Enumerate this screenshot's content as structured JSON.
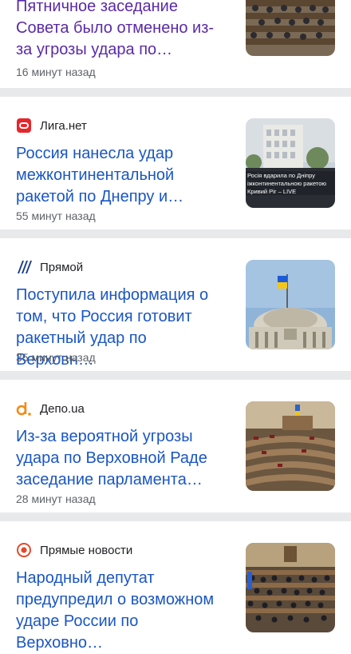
{
  "feed": [
    {
      "source": "",
      "headline": "Пятничное заседание Совета было отменено из-за угрозы удара по…",
      "time": "16 минут назад"
    },
    {
      "source": "Лига.нет",
      "logo_icon": "liga-logo-icon",
      "headline": "Россия нанесла удар межконтинентальной ракетой по Днепру и…",
      "time": "55 минут назад",
      "thumb_caption": [
        "Росія вдарила по Дніпру",
        "іжконтинентальною ракетою",
        "Кривий Ріг – LIVE"
      ]
    },
    {
      "source": "Прямой",
      "logo_icon": "pryamoy-logo-icon",
      "headline": "Поступила информация о том, что Россия готовит ракетный удар по Верховн…",
      "time": "35 минут назад"
    },
    {
      "source": "Депо.ua",
      "logo_icon": "depo-logo-icon",
      "headline": "Из-за вероятной угрозы удара по Верховной Раде заседание парламента…",
      "time": "28 минут назад"
    },
    {
      "source": "Прямые новости",
      "logo_icon": "pryamye-novosti-logo-icon",
      "headline": "Народный депутат предупредил о возможном ударе России по Верховно…",
      "time": ""
    }
  ],
  "colors": {
    "headline": "#1a56c4",
    "visited_headline": "#5a2aa8",
    "divider": "#e8e9eb",
    "meta": "#5f6368"
  }
}
